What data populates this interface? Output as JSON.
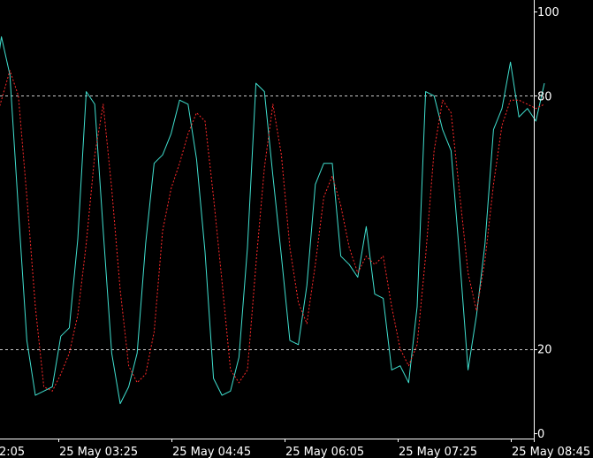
{
  "colors": {
    "background": "#000000",
    "axis": "#ffffff",
    "main_line": "#40e0d0",
    "signal_line": "#ff2a2a",
    "level_line": "#c8c8c8"
  },
  "chart_data": {
    "type": "line",
    "title": "",
    "xlabel": "",
    "ylabel": "",
    "ylim": [
      0,
      100
    ],
    "y_ticks": [
      "100",
      "80",
      "20",
      "0"
    ],
    "levels": [
      80,
      20
    ],
    "x_ticks": [
      "2:05",
      "25 May 03:25",
      "25 May 04:45",
      "25 May 06:05",
      "25 May 07:25",
      "25 May 08:45"
    ],
    "grid": false,
    "series": [
      {
        "name": "",
        "style": "solid",
        "color": "#40e0d0",
        "values": [
          80,
          94,
          85,
          53,
          22,
          9,
          10,
          11,
          23,
          25,
          46,
          81,
          78,
          48,
          19,
          7,
          11,
          19,
          45,
          64,
          66,
          71,
          79,
          78,
          65,
          43,
          13,
          9,
          10,
          18,
          44,
          83,
          81,
          61,
          42,
          22,
          21,
          35,
          59,
          64,
          64,
          42,
          40,
          37,
          49,
          33,
          32,
          15,
          16,
          12,
          30,
          81,
          80,
          72,
          67,
          42,
          15,
          28,
          45,
          72,
          77,
          88,
          75,
          77,
          74,
          83
        ]
      },
      {
        "name": "",
        "style": "dashed",
        "color": "#ff2a2a",
        "values": [
          72,
          79,
          86,
          80,
          56,
          30,
          11,
          10,
          14,
          19,
          28,
          45,
          66,
          78,
          58,
          34,
          16,
          12,
          14,
          24,
          48,
          58,
          64,
          71,
          76,
          74,
          56,
          36,
          15,
          12,
          15,
          40,
          63,
          78,
          66,
          44,
          31,
          26,
          40,
          56,
          61,
          54,
          44,
          38,
          42,
          40,
          42,
          30,
          20,
          16,
          21,
          42,
          67,
          79,
          76,
          57,
          38,
          29,
          41,
          59,
          73,
          79,
          79,
          78,
          77,
          78
        ]
      }
    ]
  }
}
